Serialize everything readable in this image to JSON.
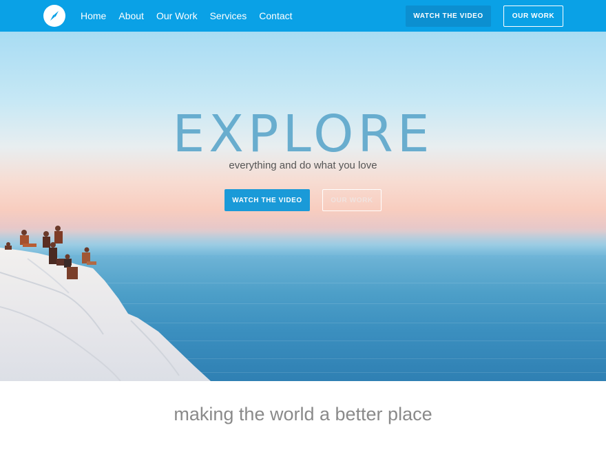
{
  "nav": {
    "links": [
      "Home",
      "About",
      "Our Work",
      "Services",
      "Contact"
    ],
    "watch_label": "WATCH THE VIDEO",
    "work_label": "OUR WORK"
  },
  "hero": {
    "title": "EXPLORE",
    "subtitle": "everything and do what you love",
    "watch_label": "WATCH THE VIDEO",
    "work_label": "OUR WORK"
  },
  "section": {
    "tagline": "making the world a better place"
  },
  "colors": {
    "nav_background": "#0aa1e6",
    "button_primary": "#1a9ad8",
    "title_color": "#5fa8cc"
  },
  "icons": {
    "logo": "compass-icon"
  }
}
